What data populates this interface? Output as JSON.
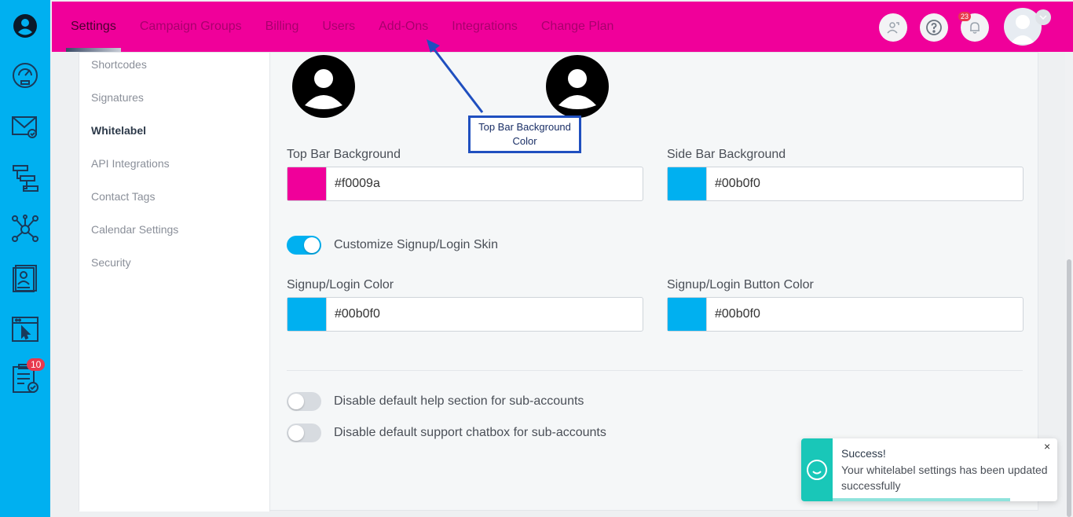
{
  "topbar": {
    "nav": [
      "Settings",
      "Campaign Groups",
      "Billing",
      "Users",
      "Add-Ons",
      "Integrations",
      "Change Plan"
    ],
    "notification_count": "23",
    "bg_color": "#f0009a"
  },
  "sidebar": {
    "bg_color": "#00b0f0",
    "icons": [
      "account-circle-icon",
      "dashboard-gauge-icon",
      "email-campaign-icon",
      "workflow-icon",
      "network-icon",
      "contact-card-icon",
      "browser-cursor-icon",
      "task-checklist-icon"
    ],
    "task_badge": "10"
  },
  "subnav": {
    "items": [
      "Shortcodes",
      "Signatures",
      "Whitelabel",
      "API Integrations",
      "Contact Tags",
      "Calendar Settings",
      "Security"
    ],
    "active": "Whitelabel"
  },
  "fields": {
    "top_bar_bg": {
      "label": "Top Bar Background",
      "value": "#f0009a",
      "swatch": "#f0009a"
    },
    "side_bar_bg": {
      "label": "Side Bar Background",
      "value": "#00b0f0",
      "swatch": "#00b0f0"
    },
    "signup_color": {
      "label": "Signup/Login Color",
      "value": "#00b0f0",
      "swatch": "#00b0f0"
    },
    "signup_button_color": {
      "label": "Signup/Login Button Color",
      "value": "#00b0f0",
      "swatch": "#00b0f0"
    }
  },
  "toggles": {
    "customize_skin": {
      "label": "Customize Signup/Login Skin",
      "on": true
    },
    "disable_help": {
      "label": "Disable default help section for sub-accounts",
      "on": false
    },
    "disable_chatbox": {
      "label": "Disable default support chatbox for sub-accounts",
      "on": false
    }
  },
  "annotation": {
    "text": "Top Bar Background Color"
  },
  "toast": {
    "title": "Success!",
    "message": "Your whitelabel settings has been updated successfully",
    "close": "×",
    "accent": "#19c7b8"
  }
}
